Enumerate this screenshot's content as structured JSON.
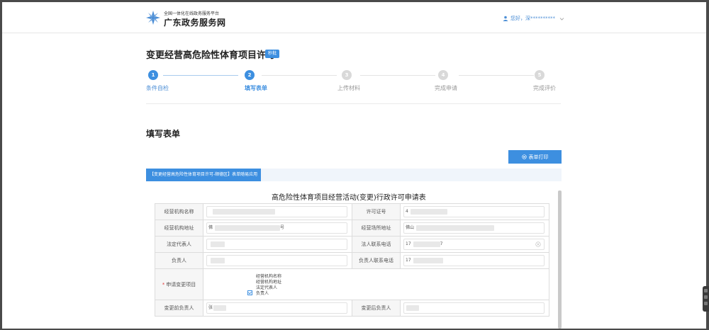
{
  "header": {
    "logo_subtitle": "全国一体化在线政务服务平台",
    "logo_title": "广东政务服务网",
    "user_greeting": "您好，深**********"
  },
  "page": {
    "title": "变更经营高危险性体育项目许可",
    "badge": "秒批"
  },
  "steps": [
    {
      "number": "1",
      "label": "条件自检",
      "state": "done"
    },
    {
      "number": "2",
      "label": "填写表单",
      "state": "current"
    },
    {
      "number": "3",
      "label": "上传材料",
      "state": "pending"
    },
    {
      "number": "4",
      "label": "完成申请",
      "state": "pending"
    },
    {
      "number": "5",
      "label": "完成评价",
      "state": "pending"
    }
  ],
  "section": {
    "title": "填写表单",
    "print_button": "表单打印",
    "banner_tag": "【变更经营高危险性体育项目许可-顺德区】表单随易应用"
  },
  "form": {
    "doc_title": "高危险性体育项目经营活动(变更)行政许可申请表",
    "rows": {
      "r1": {
        "l1": "经营机构名称",
        "v1": "",
        "l2": "许可证号",
        "v2": "4"
      },
      "r2": {
        "l1": "经营机构地址",
        "v1": "佛",
        "v1_tail": "号",
        "l2": "经营场所地址",
        "v2": "佛山"
      },
      "r3": {
        "l1": "法定代表人",
        "v1": "",
        "l2": "法人联系电话",
        "v2": "17",
        "v2_tail": "7"
      },
      "r4": {
        "l1": "负责人",
        "v1": "",
        "l2": "负责人联系电话",
        "v2": "17"
      },
      "r5": {
        "l1": "申请变更项目",
        "options": [
          {
            "label": "经营机构名称",
            "checked": false
          },
          {
            "label": "经营机构地址",
            "checked": false
          },
          {
            "label": "法定代表人",
            "checked": false
          },
          {
            "label": "负责人",
            "checked": true
          }
        ]
      },
      "r6": {
        "l1": "变更前负责人",
        "v1": "张",
        "l2": "变更后负责人",
        "v2": ""
      }
    }
  },
  "colors": {
    "accent": "#3d8fe0",
    "required": "#e23c3c"
  }
}
